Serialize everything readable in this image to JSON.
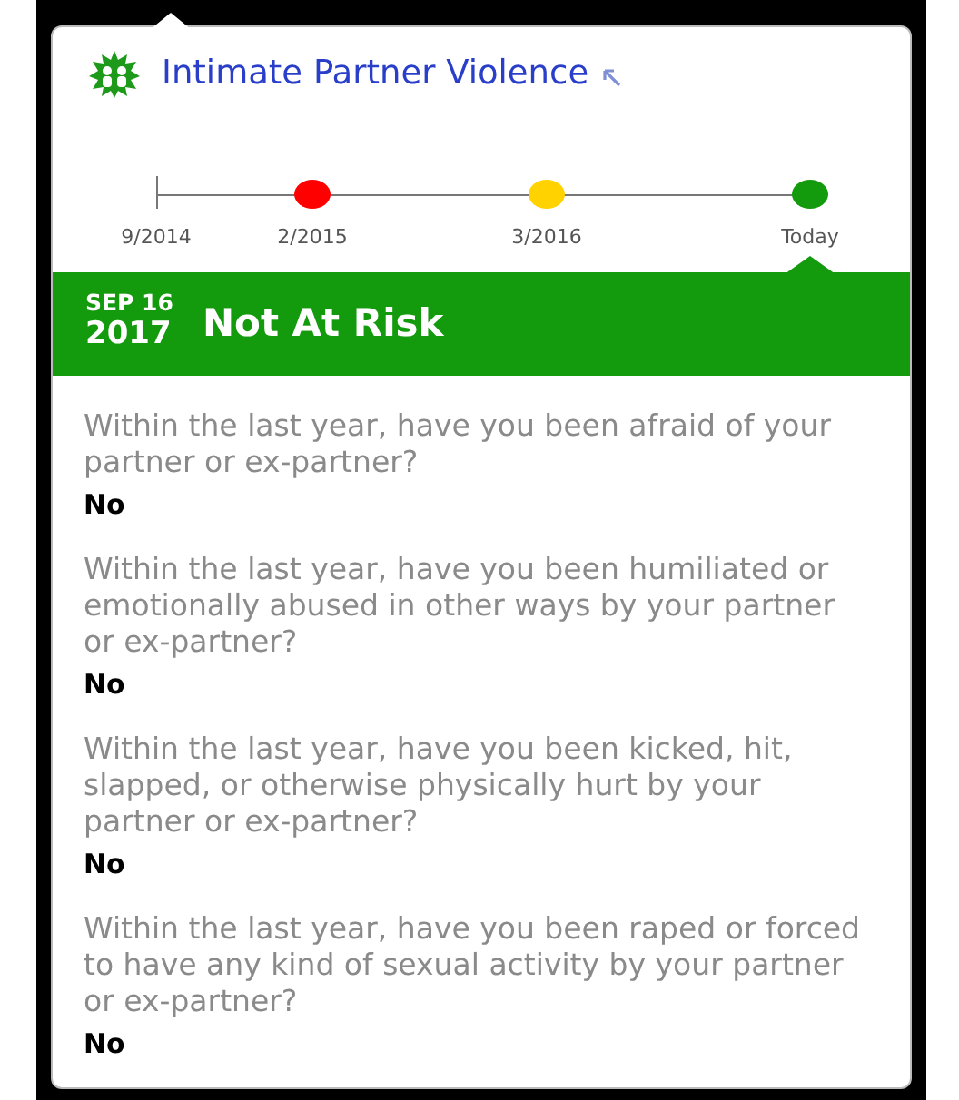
{
  "header": {
    "title": "Intimate Partner Violence"
  },
  "timeline": [
    {
      "kind": "tick",
      "label": "9/2014",
      "selected": false
    },
    {
      "kind": "dot",
      "label": "2/2015",
      "color": "#ff0000",
      "selected": false
    },
    {
      "kind": "dot",
      "label": "3/2016",
      "color": "#ffd200",
      "selected": false
    },
    {
      "kind": "dot",
      "label": "Today",
      "color": "#139a0d",
      "selected": true
    }
  ],
  "banner": {
    "month_day": "SEP 16",
    "year": "2017",
    "status": "Not At Risk",
    "color": "#139a0d"
  },
  "questions": [
    {
      "question": "Within the last year, have you been afraid of your partner or ex-partner?",
      "answer": "No"
    },
    {
      "question": "Within the last year, have you been humiliated or emotionally abused in other ways by your partner or ex-partner?",
      "answer": "No"
    },
    {
      "question": "Within the last year, have you been kicked, hit, slapped, or otherwise physically hurt by your partner or ex-partner?",
      "answer": "No"
    },
    {
      "question": "Within the last year, have you been raped or forced to have any kind of sexual activity by your partner or ex-partner?",
      "answer": "No"
    }
  ]
}
